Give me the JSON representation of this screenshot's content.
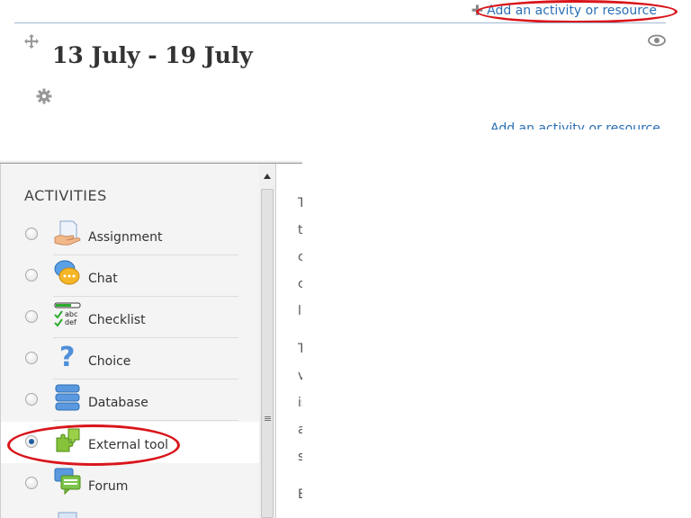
{
  "section": {
    "add_activity_label": "Add an activity or resource",
    "title": "13 July - 19 July",
    "icons": [
      "move-icon",
      "eye-icon",
      "gear-icon"
    ]
  },
  "chooser": {
    "category_heading": "ACTIVITIES",
    "items": [
      {
        "label": "Assignment",
        "icon": "assignment-icon",
        "selected": false
      },
      {
        "label": "Chat",
        "icon": "chat-icon",
        "selected": false
      },
      {
        "label": "Checklist",
        "icon": "checklist-icon",
        "selected": false
      },
      {
        "label": "Choice",
        "icon": "choice-icon",
        "selected": false
      },
      {
        "label": "Database",
        "icon": "database-icon",
        "selected": false
      },
      {
        "label": "External tool",
        "icon": "external-tool-icon",
        "selected": true
      },
      {
        "label": "Forum",
        "icon": "forum-icon",
        "selected": false
      }
    ],
    "description_glyphs": [
      "T",
      "t",
      "c",
      "c",
      "l",
      "T",
      "v",
      "is",
      "a",
      "s",
      "E"
    ]
  },
  "colors": {
    "link": "#2b6fb5",
    "highlight_oval": "#d9151b",
    "selected_radio": "#1f5fa0"
  }
}
